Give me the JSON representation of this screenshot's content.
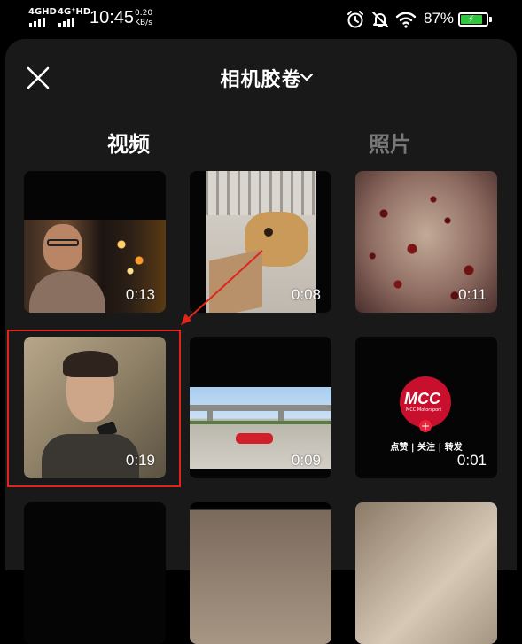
{
  "status_bar": {
    "network1": "4GHD",
    "network2": "4G⁺HD",
    "time": "10:45",
    "speed_value": "0.20",
    "speed_unit": "KB/s",
    "battery_percent": "87%",
    "battery_level": 0.87,
    "battery_color": "#2ec93b",
    "icons": [
      "alarm-icon",
      "mute-bell-icon",
      "wifi-icon",
      "battery-icon"
    ]
  },
  "header": {
    "title": "相机胶卷",
    "close_icon": "close-icon",
    "dropdown_icon": "chevron-down-icon"
  },
  "tabs": [
    {
      "label": "视频",
      "active": true
    },
    {
      "label": "照片",
      "active": false
    }
  ],
  "videos": [
    {
      "duration": "0:13"
    },
    {
      "duration": "0:08"
    },
    {
      "duration": "0:11"
    },
    {
      "duration": "0:19",
      "highlighted": true
    },
    {
      "duration": "0:09"
    },
    {
      "duration": "0:01",
      "logo_text": "MCC",
      "logo_sub": "MCC Motorsport",
      "caption": "点赞 | 关注 | 转发"
    }
  ],
  "annotation": {
    "color": "#e1251b"
  }
}
